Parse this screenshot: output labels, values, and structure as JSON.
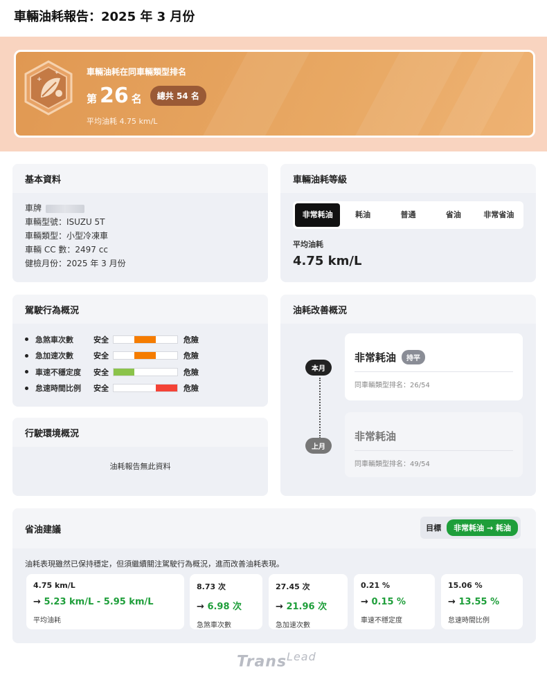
{
  "header": {
    "title": "車輛油耗報告：2025 年 3 月份"
  },
  "banner": {
    "subtitle": "車輛油耗在同車輛類型排名",
    "rank_prefix": "第",
    "rank_number": "26",
    "rank_suffix": "名",
    "total": "總共 54 名",
    "avg": "平均油耗 4.75 km/L"
  },
  "basic": {
    "title": "基本資料",
    "plate_label": "車牌",
    "model": "車輛型號：ISUZU 5T",
    "type": "車輛類型：小型冷凍車",
    "cc": "車輛 CC 數：2497 cc",
    "inspect": "健檢月份：2025 年 3 月份"
  },
  "grade": {
    "title": "車輛油耗等級",
    "tabs": [
      "非常耗油",
      "耗油",
      "普通",
      "省油",
      "非常省油"
    ],
    "active_tab": "非常耗油",
    "avg_label": "平均油耗",
    "avg_value": "4.75 km/L"
  },
  "behavior": {
    "title": "駕駛行為概況",
    "safe_label": "安全",
    "danger_label": "危險",
    "items": [
      {
        "name": "急煞車次數",
        "level": "medium",
        "color": "#f57c00"
      },
      {
        "name": "急加速次數",
        "level": "medium",
        "color": "#f57c00"
      },
      {
        "name": "車速不穩定度",
        "level": "low",
        "color": "#8bc34a"
      },
      {
        "name": "怠速時間比例",
        "level": "high",
        "color": "#f44336"
      }
    ]
  },
  "environment": {
    "title": "行駛環境概況",
    "empty": "油耗報告無此資料"
  },
  "improvement": {
    "title": "油耗改善概況",
    "current_label": "本月",
    "previous_label": "上月",
    "current": {
      "grade": "非常耗油",
      "status": "持平",
      "rank": "同車輛類型排名：26/54"
    },
    "previous": {
      "grade": "非常耗油",
      "rank": "同車輛類型排名：49/54"
    }
  },
  "advice": {
    "title": "省油建議",
    "target_label": "目標",
    "target_value": "非常耗油 → 耗油",
    "text": "油耗表現雖然已保持穩定，但須繼續關注駕駛行為概況，進而改善油耗表現。",
    "metrics": [
      {
        "current": "4.75 km/L",
        "arrow": "→",
        "target": "5.23 km/L - 5.95 km/L",
        "label": "平均油耗"
      },
      {
        "current": "8.73 次",
        "arrow": "→",
        "target": "6.98 次",
        "label": "急煞車次數"
      },
      {
        "current": "27.45 次",
        "arrow": "→",
        "target": "21.96 次",
        "label": "急加速次數"
      },
      {
        "current": "0.21 %",
        "arrow": "→",
        "target": "0.15 %",
        "label": "車速不穩定度"
      },
      {
        "current": "15.06 %",
        "arrow": "→",
        "target": "13.55 %",
        "label": "怠速時間比例"
      }
    ]
  },
  "footer": {
    "logo_main": "Trans",
    "logo_sup": "Lead"
  }
}
